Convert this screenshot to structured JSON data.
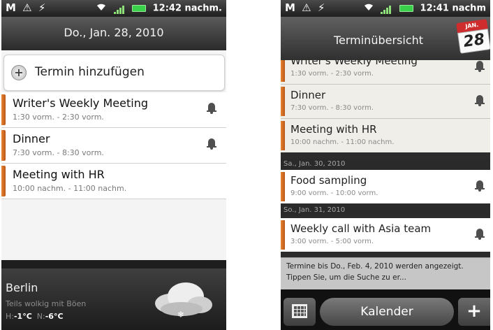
{
  "left_screen": {
    "status": {
      "icons_left": "M ⚠ ⚡",
      "time": "12:42 nachm."
    },
    "date_header": "Do., Jan. 28, 2010",
    "add_button_label": "Termin hinzufügen",
    "events": [
      {
        "title": "Writer's Weekly Meeting",
        "time": "1:30 vorm. - 2:30 vorm.",
        "reminder": true
      },
      {
        "title": "Dinner",
        "time": "7:30 vorm. - 8:30 vorm.",
        "reminder": true
      },
      {
        "title": "Meeting with HR",
        "time": "10:00 nachm. - 11:00 nachm.",
        "reminder": false
      }
    ],
    "weather": {
      "city": "Berlin",
      "condition": "Teils wolkig mit Böen",
      "high_label": "H:",
      "high": "-1°C",
      "low_label": "N:",
      "low": "-6°C",
      "icon": "snow-cloud-icon"
    }
  },
  "right_screen": {
    "status": {
      "icons_left": "M ⚠ ⚡",
      "time": "12:41 nachm"
    },
    "title": "Terminübersicht",
    "calendar_icon": {
      "month": "JAN.",
      "day": "28"
    },
    "events_top": [
      {
        "title": "Writer's Weekly Meeting",
        "time": "1:30 vorm. - 2:30 vorm."
      },
      {
        "title": "Dinner",
        "time": "7:30 vorm. - 8:30 vorm."
      },
      {
        "title": "Meeting with HR",
        "time": "10:00 nachm. - 11:00 nachm."
      }
    ],
    "day1": "Sa., Jan. 30, 2010",
    "day1_events": [
      {
        "title": "Food sampling",
        "time": "9:00 vorm. - 10:00 vorm."
      }
    ],
    "day2": "So., Jan. 31, 2010",
    "day2_events": [
      {
        "title": "Weekly call with Asia team",
        "time": "3:00 vorm. - 5:00 vorm."
      }
    ],
    "notice": "Termine bis Do., Feb. 4, 2010 werden angezeigt. Tippen Sie, um die Suche zu er...",
    "bottom_tab": "Kalender",
    "plus_label": "+"
  }
}
